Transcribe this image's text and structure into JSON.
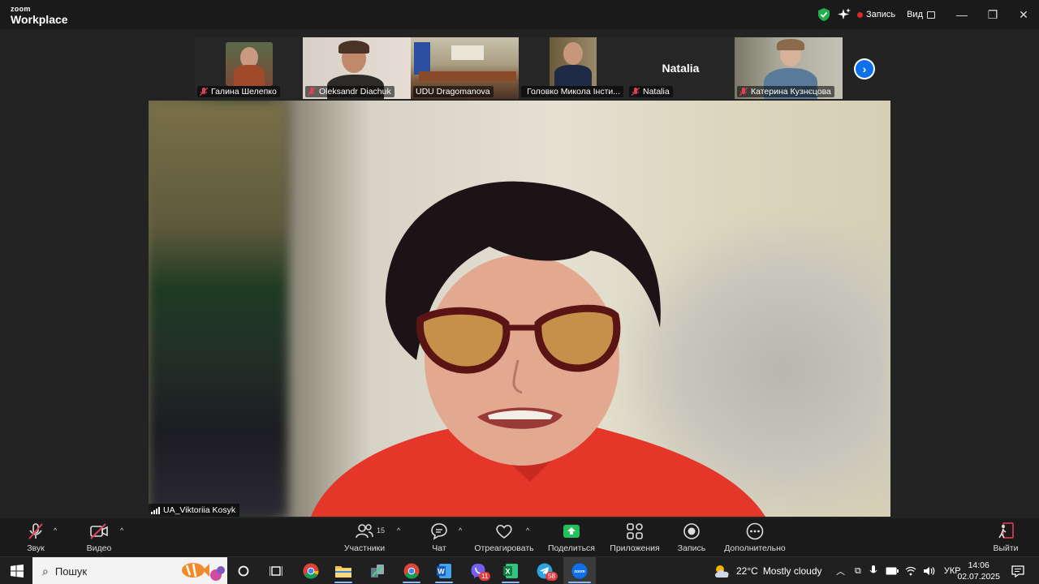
{
  "titlebar": {
    "brand_top": "zoom",
    "brand_bottom": "Workplace",
    "record_label": "Запись",
    "view_label": "Вид",
    "minimize": "—",
    "restore": "❐",
    "close": "✕"
  },
  "participants": [
    {
      "name": "Галина Шелепко",
      "muted": true
    },
    {
      "name": "Oleksandr Diachuk",
      "muted": true
    },
    {
      "name": "UDU Dragomanova",
      "muted": false
    },
    {
      "name": "Головко Микола Інсти...",
      "muted": true
    },
    {
      "name": "Natalia",
      "muted": true,
      "avatar_text": "Natalia"
    },
    {
      "name": "Катерина Кузнєцова",
      "muted": true
    }
  ],
  "speaker": {
    "name": "UA_Viktoriia Kosyk"
  },
  "controls": {
    "audio": "Звук",
    "video": "Видео",
    "participants": "Участники",
    "participants_count": "15",
    "chat": "Чат",
    "react": "Отреагировать",
    "share": "Поделиться",
    "apps": "Приложения",
    "record": "Запись",
    "more": "Дополнительно",
    "leave": "Выйти"
  },
  "taskbar": {
    "search_placeholder": "Пошук",
    "weather_temp": "22°C",
    "weather_desc": "Mostly cloudy",
    "language": "УКР",
    "time": "14:06",
    "date": "02.07.2025",
    "viber_badge": "11",
    "telegram_badge": "58"
  },
  "colors": {
    "zoom_blue": "#0e71eb",
    "share_green": "#20c05c",
    "muted_red": "#e0405a",
    "record_red": "#e02828"
  }
}
